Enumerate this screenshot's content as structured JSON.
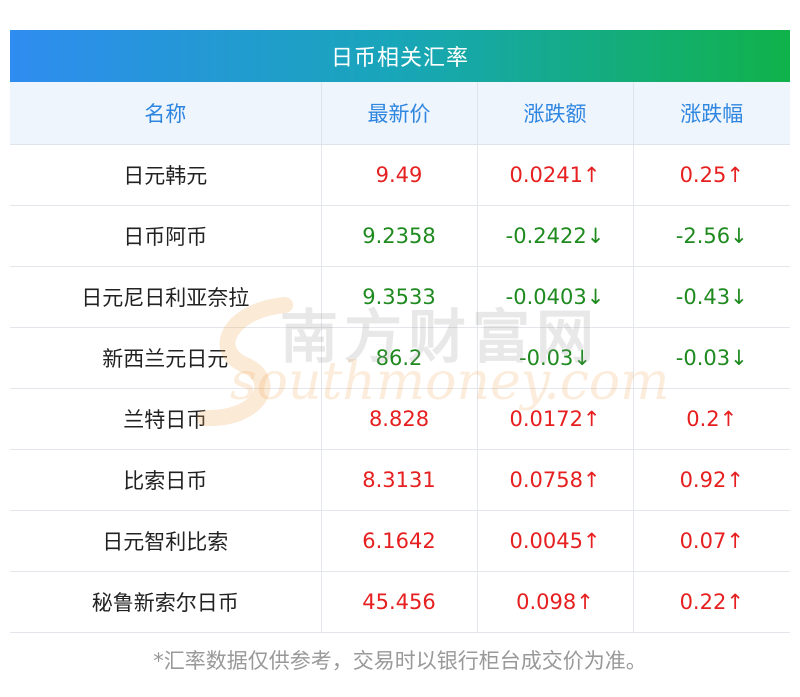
{
  "title": "日币相关汇率",
  "columns": [
    "名称",
    "最新价",
    "涨跌额",
    "涨跌幅"
  ],
  "rows": [
    {
      "name": "日元韩元",
      "price": "9.49",
      "change": "0.0241↑",
      "pct": "0.25↑",
      "dir": "up"
    },
    {
      "name": "日币阿币",
      "price": "9.2358",
      "change": "-0.2422↓",
      "pct": "-2.56↓",
      "dir": "down"
    },
    {
      "name": "日元尼日利亚奈拉",
      "price": "9.3533",
      "change": "-0.0403↓",
      "pct": "-0.43↓",
      "dir": "down"
    },
    {
      "name": "新西兰元日元",
      "price": "86.2",
      "change": "-0.03↓",
      "pct": "-0.03↓",
      "dir": "down"
    },
    {
      "name": "兰特日币",
      "price": "8.828",
      "change": "0.0172↑",
      "pct": "0.2↑",
      "dir": "up"
    },
    {
      "name": "比索日币",
      "price": "8.3131",
      "change": "0.0758↑",
      "pct": "0.92↑",
      "dir": "up"
    },
    {
      "name": "日元智利比索",
      "price": "6.1642",
      "change": "0.0045↑",
      "pct": "0.07↑",
      "dir": "up"
    },
    {
      "name": "秘鲁新索尔日币",
      "price": "45.456",
      "change": "0.098↑",
      "pct": "0.22↑",
      "dir": "up"
    }
  ],
  "footnote": "*汇率数据仅供参考，交易时以银行柜台成交价为准。",
  "watermark": {
    "cn": "南方财富网",
    "en": "southmoney.com"
  },
  "colors": {
    "up": "#e62020",
    "down": "#1f8a1f",
    "header_text": "#2f86e0",
    "title_start": "#2f8cf0",
    "title_end": "#10b24a"
  }
}
